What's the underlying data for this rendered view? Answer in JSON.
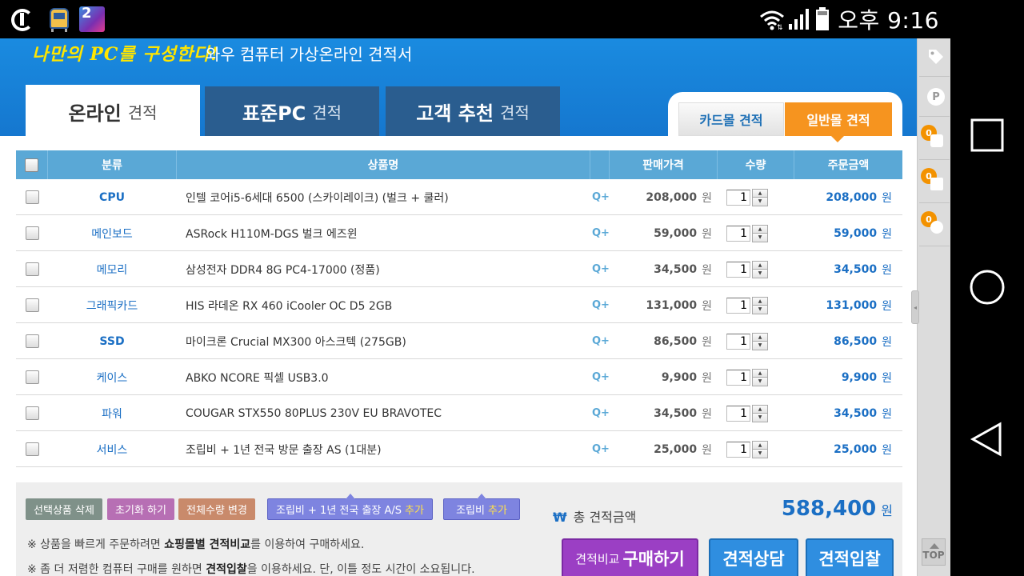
{
  "status_bar": {
    "time": "오후 9:16",
    "apps": [
      "u-plus-icon",
      "train-app-icon",
      "game-app-icon"
    ],
    "game_badge": "2"
  },
  "header": {
    "script_title": "나만의 PC를 구성한다!",
    "subtitle": "와우 컴퓨터 가상온라인 견적서"
  },
  "tabs": [
    {
      "strong": "온라인",
      "light": "견적"
    },
    {
      "strong": "표준PC",
      "light": "견적"
    },
    {
      "strong": "고객 추천",
      "light": "견적"
    }
  ],
  "mall_tabs": {
    "card": "카드몰 견적",
    "general": "일반몰 견적"
  },
  "sidebar": {
    "badges": [
      "0",
      "0",
      "0"
    ],
    "top_label": "TOP"
  },
  "table": {
    "headers": {
      "category": "분류",
      "product": "상품명",
      "price": "판매가격",
      "qty": "수량",
      "total": "주문금액"
    },
    "currency": "원",
    "zoom_label": "Q+",
    "rows": [
      {
        "category": "CPU",
        "name": "인텔 코어i5-6세대 6500 (스카이레이크) (벌크 + 쿨러)",
        "price": "208,000",
        "qty": "1",
        "total": "208,000"
      },
      {
        "category": "메인보드",
        "name": "ASRock H110M-DGS 벌크 에즈윈",
        "price": "59,000",
        "qty": "1",
        "total": "59,000"
      },
      {
        "category": "메모리",
        "name": "삼성전자 DDR4 8G PC4-17000 (정품)",
        "price": "34,500",
        "qty": "1",
        "total": "34,500"
      },
      {
        "category": "그래픽카드",
        "name": "HIS 라데온 RX 460 iCooler OC D5 2GB",
        "price": "131,000",
        "qty": "1",
        "total": "131,000"
      },
      {
        "category": "SSD",
        "name": "마이크론 Crucial MX300 아스크텍 (275GB)",
        "price": "86,500",
        "qty": "1",
        "total": "86,500"
      },
      {
        "category": "케이스",
        "name": "ABKO NCORE 픽셀 USB3.0",
        "price": "9,900",
        "qty": "1",
        "total": "9,900"
      },
      {
        "category": "파워",
        "name": "COUGAR STX550 80PLUS 230V EU BRAVOTEC",
        "price": "34,500",
        "qty": "1",
        "total": "34,500"
      },
      {
        "category": "서비스",
        "name": "조립비 + 1년 전국 방문 출장 AS (1대분)",
        "price": "25,000",
        "qty": "1",
        "total": "25,000"
      }
    ]
  },
  "actions": {
    "delete_selected": "선택상품 삭제",
    "reset": "초기화 하기",
    "change_all_qty": "전체수량 변경",
    "assembly_as": "조립비 + 1년 전국 출장 A/S",
    "assembly": "조립비",
    "add": "추가"
  },
  "summary": {
    "won_symbol": "₩",
    "label": "총 견적금액",
    "amount": "588,400",
    "currency": "원"
  },
  "notes": {
    "n1_pre": "※ 상품을 빠르게 주문하려면",
    "n1_bold": "쇼핑몰별 견적비교",
    "n1_post": "를 이용하여 구매하세요.",
    "n2_pre": "※ 좀 더 저렴한 컴퓨터 구매를 원하면",
    "n2_bold": "견적입찰",
    "n2_post": "을 이용하세요. 단, 이틀 정도 시간이 소요됩니다."
  },
  "big_buttons": {
    "buy_small": "견적비교",
    "buy": "구매하기",
    "consult": "견적상담",
    "bid": "견적입찰"
  }
}
